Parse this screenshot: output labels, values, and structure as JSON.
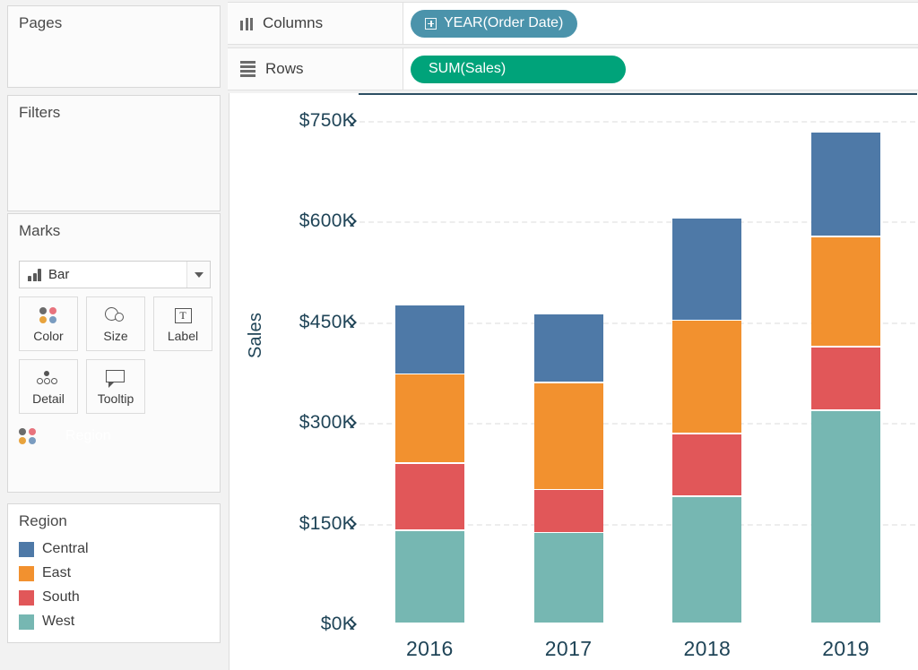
{
  "sidebar": {
    "pages": {
      "title": "Pages"
    },
    "filters": {
      "title": "Filters"
    },
    "marks": {
      "title": "Marks",
      "mark_type": "Bar",
      "mark_type_icon": "bar-chart-icon",
      "dropdown_icon": "chevron-down-icon",
      "buttons": [
        {
          "label": "Color",
          "icon": "color-dots-icon"
        },
        {
          "label": "Size",
          "icon": "size-circles-icon"
        },
        {
          "label": "Label",
          "icon": "text-label-icon"
        },
        {
          "label": "Detail",
          "icon": "detail-dots-icon"
        },
        {
          "label": "Tooltip",
          "icon": "tooltip-bubble-icon"
        }
      ],
      "encoding_pill": {
        "label": "Region",
        "icon": "color-dots-icon",
        "color": "#4b93ab"
      }
    },
    "legend": {
      "title": "Region",
      "items": [
        {
          "label": "Central",
          "color": "#4e79a7"
        },
        {
          "label": "East",
          "color": "#f2912f"
        },
        {
          "label": "South",
          "color": "#e15759"
        },
        {
          "label": "West",
          "color": "#76b7b2"
        }
      ]
    }
  },
  "shelves": {
    "columns": {
      "label": "Columns",
      "icon": "columns-icon",
      "pill": {
        "label": "YEAR(Order Date)",
        "icon": "plus-box-icon",
        "color": "#4b93ab"
      }
    },
    "rows": {
      "label": "Rows",
      "icon": "rows-icon",
      "pill": {
        "label": "SUM(Sales)",
        "color": "#00a37a"
      }
    }
  },
  "chart_data": {
    "type": "bar",
    "subtype": "stacked",
    "title": "",
    "xlabel": "",
    "ylabel": "Sales",
    "categories": [
      "2016",
      "2017",
      "2018",
      "2019"
    ],
    "ytick_labels": [
      "$0K",
      "$150K",
      "$300K",
      "$450K",
      "$600K",
      "$750K"
    ],
    "ytick_values": [
      0,
      150000,
      300000,
      450000,
      600000,
      750000
    ],
    "ylim": [
      0,
      750000
    ],
    "grid": true,
    "legend_position": "left-panel",
    "stack_order_bottom_to_top": [
      "West",
      "South",
      "East",
      "Central"
    ],
    "series": [
      {
        "name": "Central",
        "color": "#4e79a7",
        "values": [
          103000,
          103000,
          152000,
          156000
        ]
      },
      {
        "name": "East",
        "color": "#f2912f",
        "values": [
          133000,
          159000,
          169000,
          164000
        ]
      },
      {
        "name": "South",
        "color": "#e15759",
        "values": [
          100000,
          64000,
          93000,
          95000
        ]
      },
      {
        "name": "West",
        "color": "#76b7b2",
        "values": [
          139000,
          136000,
          190000,
          318000
        ]
      }
    ],
    "totals": [
      475000,
      462000,
      604000,
      733000
    ]
  },
  "colors": {
    "axis_text": "#1f4457",
    "axis_line": "#2c4f63",
    "gridline": "#ededed",
    "panel_bg": "#f2f2f2",
    "card_bg": "#fbfbfb",
    "dimension_pill": "#4b93ab",
    "measure_pill": "#00a37a"
  }
}
